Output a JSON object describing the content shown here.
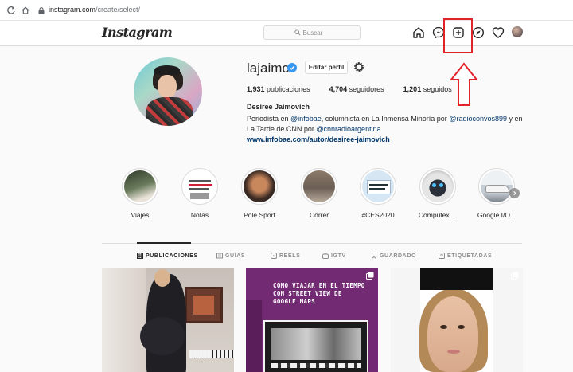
{
  "browser": {
    "url_host": "instagram.com",
    "url_path": "/create/select/"
  },
  "header": {
    "logo": "Instagram",
    "search_placeholder": "Buscar"
  },
  "profile": {
    "username": "lajaimo",
    "edit_button": "Editar perfil",
    "stats": {
      "posts_count": "1,931",
      "posts_label": "publicaciones",
      "followers_count": "4,704",
      "followers_label": "seguidores",
      "following_count": "1,201",
      "following_label": "seguidos"
    },
    "full_name": "Desiree Jaimovich",
    "bio": {
      "part1": "Periodista en ",
      "mention1": "@infobae",
      "part2": ", columnista en La Inmensa Minoría por ",
      "mention2": "@radioconvos899",
      "part3": " y en La Tarde de CNN por ",
      "mention3": "@cnnradioargentina"
    },
    "link": "www.infobae.com/autor/desiree-jaimovich"
  },
  "highlights": [
    {
      "label": "Viajes"
    },
    {
      "label": "Notas"
    },
    {
      "label": "Pole Sport"
    },
    {
      "label": "Correr"
    },
    {
      "label": "#CES2020"
    },
    {
      "label": "Computex ..."
    },
    {
      "label": "Google I/O..."
    }
  ],
  "tabs": [
    {
      "label": "PUBLICACIONES"
    },
    {
      "label": "GUÍAS"
    },
    {
      "label": "REELS"
    },
    {
      "label": "IGTV"
    },
    {
      "label": "GUARDADO"
    },
    {
      "label": "ETIQUETADAS"
    }
  ],
  "posts": {
    "post2_title": "CÓMO VIAJAR EN EL TIEMPO CON STREET VIEW DE GOOGLE MAPS"
  },
  "colors": {
    "annotation_red": "#e0242a",
    "link_blue": "#00376b",
    "verified_blue": "#3897f0"
  }
}
